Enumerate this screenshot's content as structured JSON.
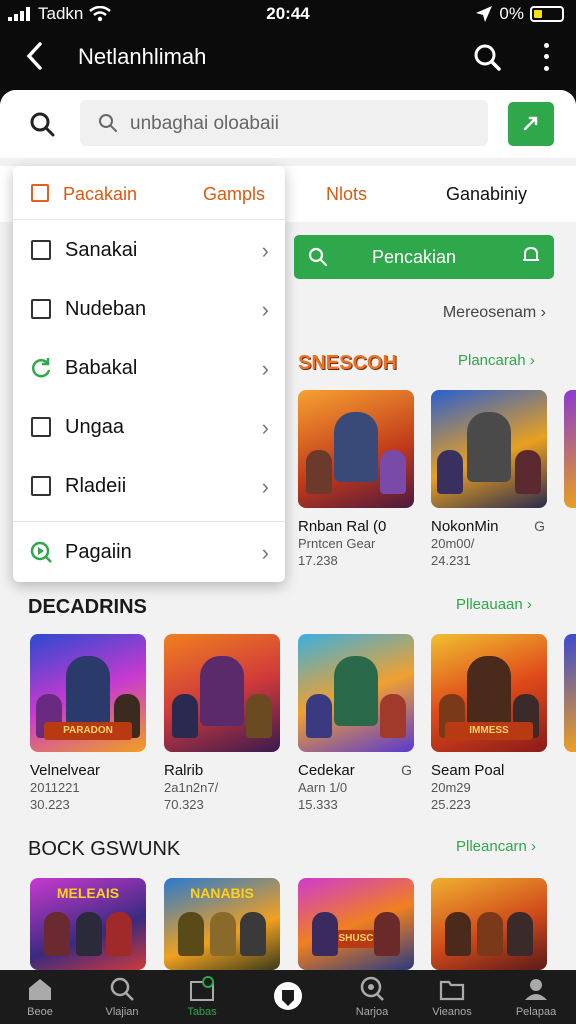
{
  "status": {
    "carrier": "Tadkn",
    "time": "20:44",
    "battery": "0%"
  },
  "appbar": {
    "title": "Netlanhlimah"
  },
  "search": {
    "placeholder": "unbaghai oloabaii"
  },
  "tabs": [
    {
      "label": "Nlots"
    },
    {
      "label": "Ganabiniy"
    }
  ],
  "filter_button": {
    "label": "Pencakian"
  },
  "see_all_top": "Mereosenam",
  "dropdown": {
    "header_label": "Pacakain",
    "header_right": "Gampls",
    "items": [
      {
        "label": "Sanakai",
        "type": "checkbox"
      },
      {
        "label": "Nudeban",
        "type": "checkbox"
      },
      {
        "label": "Babakal",
        "type": "radio"
      },
      {
        "label": "Ungaa",
        "type": "checkbox"
      },
      {
        "label": "Rladeii",
        "type": "checkbox"
      }
    ],
    "footer_label": "Pagaiin"
  },
  "sections": [
    {
      "title": "SNESCOH",
      "link": "Plancarah",
      "cards": [
        {
          "name": "Rnban Ral (0",
          "meta1": "Prntcen Gear",
          "meta2": "17.238"
        },
        {
          "name": "NokonMin",
          "meta1": "20m00/",
          "meta2": "24.231",
          "badge": "G"
        }
      ]
    },
    {
      "title": "DECADRINS",
      "link": "Plleauaan",
      "cards": [
        {
          "name": "Velnelvear",
          "meta1": "2011221",
          "meta2": "30.223",
          "banner": "PARADON"
        },
        {
          "name": "Ralrib",
          "meta1": "2a1n2n7/",
          "meta2": "70.323"
        },
        {
          "name": "Cedekar",
          "meta1": "Aarn 1/0",
          "meta2": "15.333",
          "badge": "G"
        },
        {
          "name": "Seam Poal",
          "meta1": "20m29",
          "meta2": "25.223",
          "banner": "IMMESS"
        }
      ]
    },
    {
      "title": "BOCK GSWUNK",
      "link": "Plleancarn",
      "cards": [
        {
          "banner": "MELEAIS"
        },
        {
          "banner": "NANABIS"
        },
        {
          "banner": "SHUSC"
        },
        {
          "banner": ""
        }
      ]
    }
  ],
  "bottom_nav": [
    {
      "label": "Beoe",
      "icon": "home-icon"
    },
    {
      "label": "Vlajian",
      "icon": "search-icon"
    },
    {
      "label": "Tabas",
      "icon": "tabs-icon",
      "active": true
    },
    {
      "label": "",
      "icon": "center-app-icon"
    },
    {
      "label": "Narjoa",
      "icon": "location-icon"
    },
    {
      "label": "Vieanos",
      "icon": "folder-icon"
    },
    {
      "label": "Pelapaa",
      "icon": "profile-icon"
    }
  ],
  "colors": {
    "accent_green": "#2ea84a",
    "accent_orange": "#d95a12",
    "dark": "#0b0b0b"
  }
}
